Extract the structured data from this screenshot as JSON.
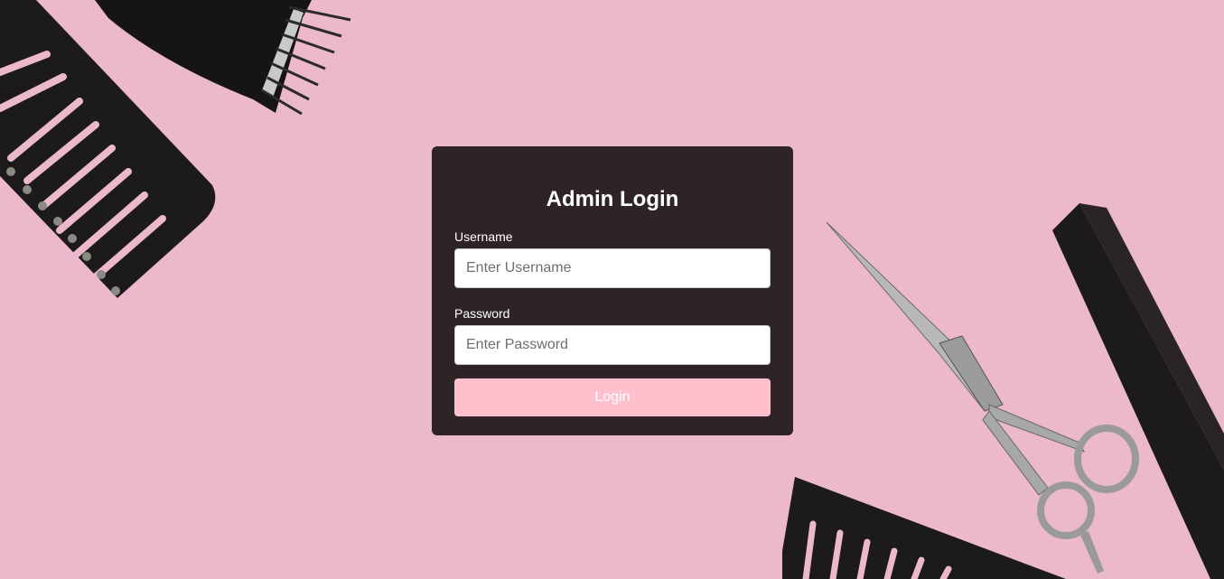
{
  "login": {
    "title": "Admin Login",
    "username_label": "Username",
    "username_placeholder": "Enter Username",
    "username_value": "",
    "password_label": "Password",
    "password_placeholder": "Enter Password",
    "password_value": "",
    "button_label": "Login"
  },
  "background": {
    "color": "#ecb8cb",
    "objects": [
      "comb-icon",
      "hair-clipper-icon",
      "scissors-icon",
      "fine-comb-icon",
      "wide-comb-icon"
    ]
  },
  "colors": {
    "card": "#2e2326",
    "button": "#ffc0cd",
    "tool": "#1c1a1b"
  }
}
